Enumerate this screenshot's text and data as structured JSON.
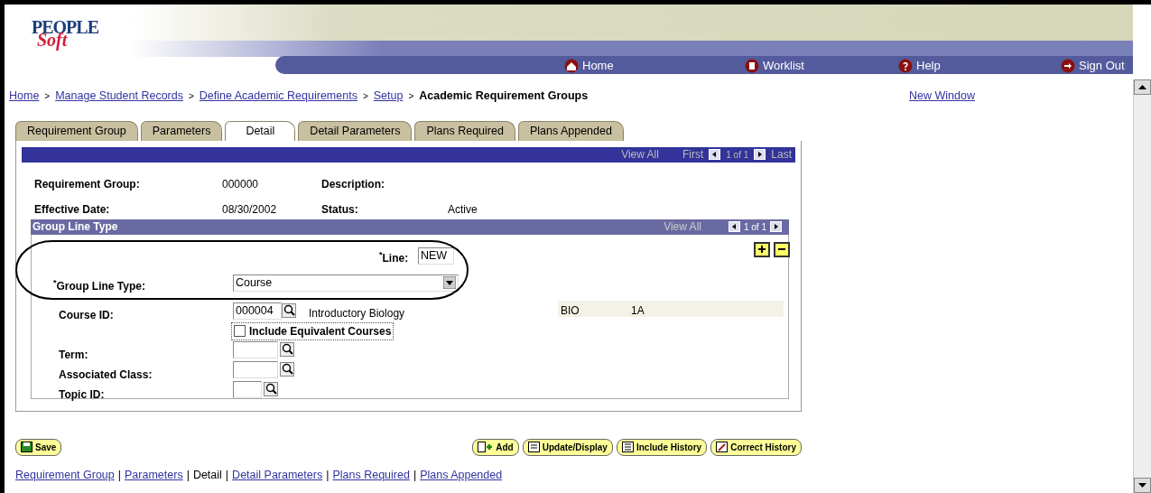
{
  "top_nav": [
    {
      "label": "Home",
      "kind": "home"
    },
    {
      "label": "Worklist",
      "kind": "worklist"
    },
    {
      "label": "Help",
      "kind": "help"
    },
    {
      "label": "Sign Out",
      "kind": "signout"
    }
  ],
  "logo": {
    "top": "PEOPLE",
    "bottom": "Soft"
  },
  "breadcrumb": [
    {
      "label": "Home",
      "kind": "link"
    },
    {
      "label": ">",
      "kind": "separator"
    },
    {
      "label": "Manage Student Records",
      "kind": "link"
    },
    {
      "label": ">",
      "kind": "separator"
    },
    {
      "label": "Define Academic Requirements",
      "kind": "link"
    },
    {
      "label": ">",
      "kind": "separator"
    },
    {
      "label": "Setup",
      "kind": "link"
    },
    {
      "label": ">",
      "kind": "separator"
    },
    {
      "label": "Academic Requirement Groups",
      "kind": "current"
    }
  ],
  "new_window": "New Window",
  "tabs": [
    {
      "label": "Requirement Group",
      "selected": false
    },
    {
      "label": "Parameters",
      "selected": false
    },
    {
      "label": "Detail",
      "selected": true
    },
    {
      "label": "Detail Parameters",
      "selected": false
    },
    {
      "label": "Plans Required",
      "selected": false
    },
    {
      "label": "Plans Appended",
      "selected": false
    }
  ],
  "header_bar": {
    "view_all": "View All",
    "first": "First",
    "count": "1 of 1",
    "last": "Last"
  },
  "summary": [
    {
      "label": "Requirement Group:",
      "value": "000000"
    },
    {
      "label": "Description:"
    },
    {
      "label": "Effective Date:",
      "value": "08/30/2002"
    },
    {
      "label": "Status:",
      "value": "Active"
    }
  ],
  "group_line": {
    "title": "Group Line Type",
    "view_all": "View All",
    "count": "1 of 1",
    "line_label": "$^{*}$Line:",
    "line_value": "NEW",
    "type_label": "$^{*}$Group Line Type:",
    "type_value": "Course",
    "course_label": "Course ID:",
    "course_value": "000004",
    "course_title": "Introductory Biology",
    "subject": "BIO",
    "catalog": "1A",
    "include_equivalent": {
      "label": "Include Equivalent Courses",
      "checked": false
    },
    "term_label": "Term:",
    "class_label": "Associated Class:",
    "topic_label": "Topic ID:"
  },
  "save_button": "Save",
  "action_buttons": [
    {
      "label": "Add",
      "kind": "add"
    },
    {
      "label": "Update/Display",
      "kind": "update"
    },
    {
      "label": "Include History",
      "kind": "history"
    },
    {
      "label": "Correct History",
      "kind": "correct"
    }
  ],
  "footer_links": [
    {
      "label": "Requirement Group",
      "kind": "link"
    },
    {
      "label": "|",
      "kind": "separator"
    },
    {
      "label": "Parameters",
      "kind": "link"
    },
    {
      "label": "|",
      "kind": "separator"
    },
    {
      "label": "Detail",
      "kind": "current"
    },
    {
      "label": "|",
      "kind": "separator"
    },
    {
      "label": "Detail Parameters",
      "kind": "link"
    },
    {
      "label": "|",
      "kind": "separator"
    },
    {
      "label": "Plans Required",
      "kind": "link"
    },
    {
      "label": "|",
      "kind": "separator"
    },
    {
      "label": "Plans Appended",
      "kind": "link"
    }
  ]
}
